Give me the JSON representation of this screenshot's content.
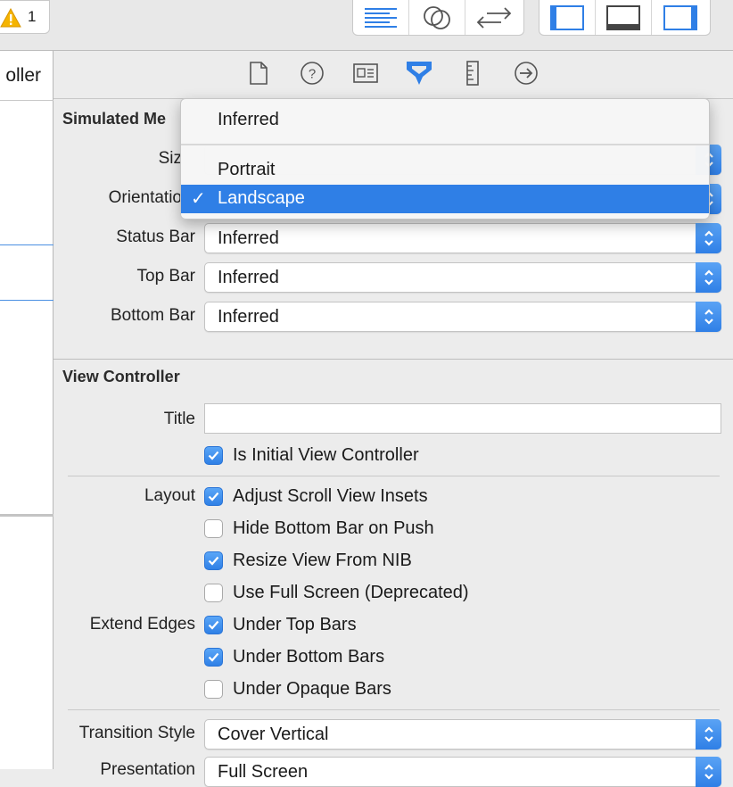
{
  "toolbar": {
    "warning_count": "1",
    "editor_buttons": [
      "align-lines-icon",
      "two-circles-icon",
      "swap-arrows-icon"
    ],
    "panel_buttons": [
      "left-panel-icon",
      "bottom-panel-icon",
      "right-panel-icon"
    ]
  },
  "left_editor": {
    "controller_label_fragment": "oller"
  },
  "inspector_tabs": [
    "file-icon",
    "help-circle-icon",
    "identity-card-icon",
    "attributes-icon",
    "ruler-icon",
    "connections-arrow-icon"
  ],
  "simulated_metrics": {
    "title": "Simulated Me",
    "size_label": "Siz",
    "orientation_label": "Orientatio",
    "status_bar": {
      "label": "Status Bar",
      "value": "Inferred"
    },
    "top_bar": {
      "label": "Top Bar",
      "value": "Inferred"
    },
    "bottom_bar": {
      "label": "Bottom Bar",
      "value": "Inferred"
    }
  },
  "dropdown": {
    "items": [
      {
        "label": "Inferred",
        "selected": false
      },
      {
        "label": "Portrait",
        "selected": false
      },
      {
        "label": "Landscape",
        "selected": true
      }
    ],
    "check_glyph": "✓"
  },
  "view_controller": {
    "title": "View Controller",
    "title_label": "Title",
    "title_value": "",
    "initial_vc": {
      "label": "Is Initial View Controller",
      "checked": true
    },
    "layout_label": "Layout",
    "layout_options": [
      {
        "label": "Adjust Scroll View Insets",
        "checked": true
      },
      {
        "label": "Hide Bottom Bar on Push",
        "checked": false
      },
      {
        "label": "Resize View From NIB",
        "checked": true
      },
      {
        "label": "Use Full Screen (Deprecated)",
        "checked": false
      }
    ],
    "extend_edges_label": "Extend Edges",
    "extend_edges_options": [
      {
        "label": "Under Top Bars",
        "checked": true
      },
      {
        "label": "Under Bottom Bars",
        "checked": true
      },
      {
        "label": "Under Opaque Bars",
        "checked": false
      }
    ],
    "transition_style": {
      "label": "Transition Style",
      "value": "Cover Vertical"
    },
    "presentation": {
      "label": "Presentation",
      "value": "Full Screen"
    }
  },
  "colors": {
    "accent": "#2f7fe6",
    "warning": "#f5b400"
  }
}
